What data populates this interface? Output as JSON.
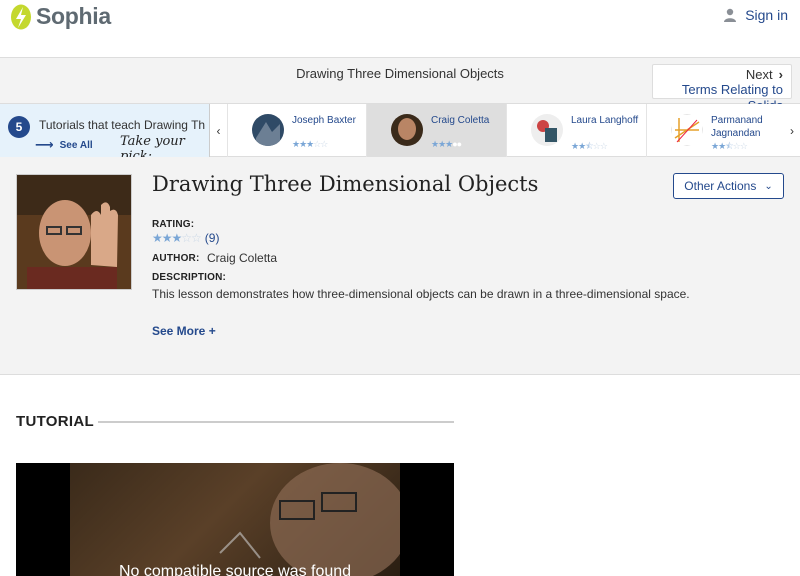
{
  "header": {
    "brand": "Sophia",
    "signin_label": "Sign in"
  },
  "titlebar": {
    "title": "Drawing Three Dimensional Objects",
    "next_label": "Next",
    "next_title": "Terms Relating to Solids"
  },
  "strip": {
    "count": "5",
    "teach_text": "Tutorials that teach Drawing Th",
    "see_all": "See All",
    "pick_text": "Take your pick:",
    "teachers": [
      {
        "name": "Joseph Baxter",
        "rating": 3
      },
      {
        "name": "Craig Coletta",
        "rating": 3
      },
      {
        "name": "Laura Langhoff",
        "rating": 2.5
      },
      {
        "name": "Parmanand Jagnandan",
        "rating": 2.5
      }
    ]
  },
  "lesson": {
    "title": "Drawing Three Dimensional Objects",
    "other_actions": "Other Actions",
    "rating_label": "RATING:",
    "rating_value": 3,
    "rating_count": "(9)",
    "author_label": "AUTHOR:",
    "author": "Craig Coletta",
    "description_label": "DESCRIPTION:",
    "description": "This lesson demonstrates how three-dimensional objects can be drawn in a three-dimensional space.",
    "see_more": "See More +"
  },
  "tutorial": {
    "heading": "TUTORIAL",
    "video_message": "No compatible source was found"
  },
  "colors": {
    "link": "#24498c",
    "panel": "#f3f3f3",
    "brand_green": "#c4d82e"
  }
}
